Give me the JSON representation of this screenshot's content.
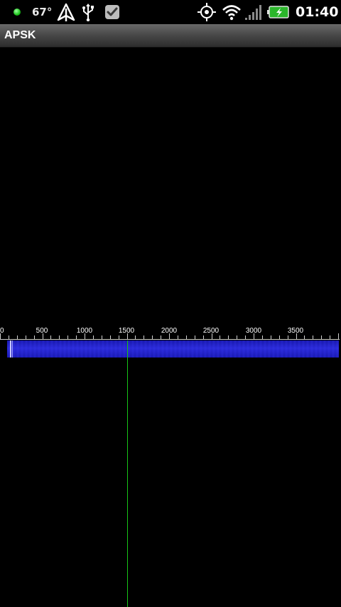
{
  "status_bar": {
    "temperature": "67°",
    "time": "01:40",
    "icons": [
      "notification-dot-icon",
      "navigation-arrow-icon",
      "usb-icon",
      "checkbox-icon",
      "gps-crosshair-icon",
      "wifi-icon",
      "signal-bars-icon",
      "battery-charging-icon"
    ]
  },
  "app": {
    "title": "APSK"
  },
  "scale": {
    "labels": [
      "0",
      "500",
      "1000",
      "1500",
      "2000",
      "2500",
      "3000",
      "3500"
    ]
  },
  "colors": {
    "waterfall": "#2a2ad6",
    "cursor": "#16c416",
    "title_bar_top": "#6a6a6a"
  }
}
